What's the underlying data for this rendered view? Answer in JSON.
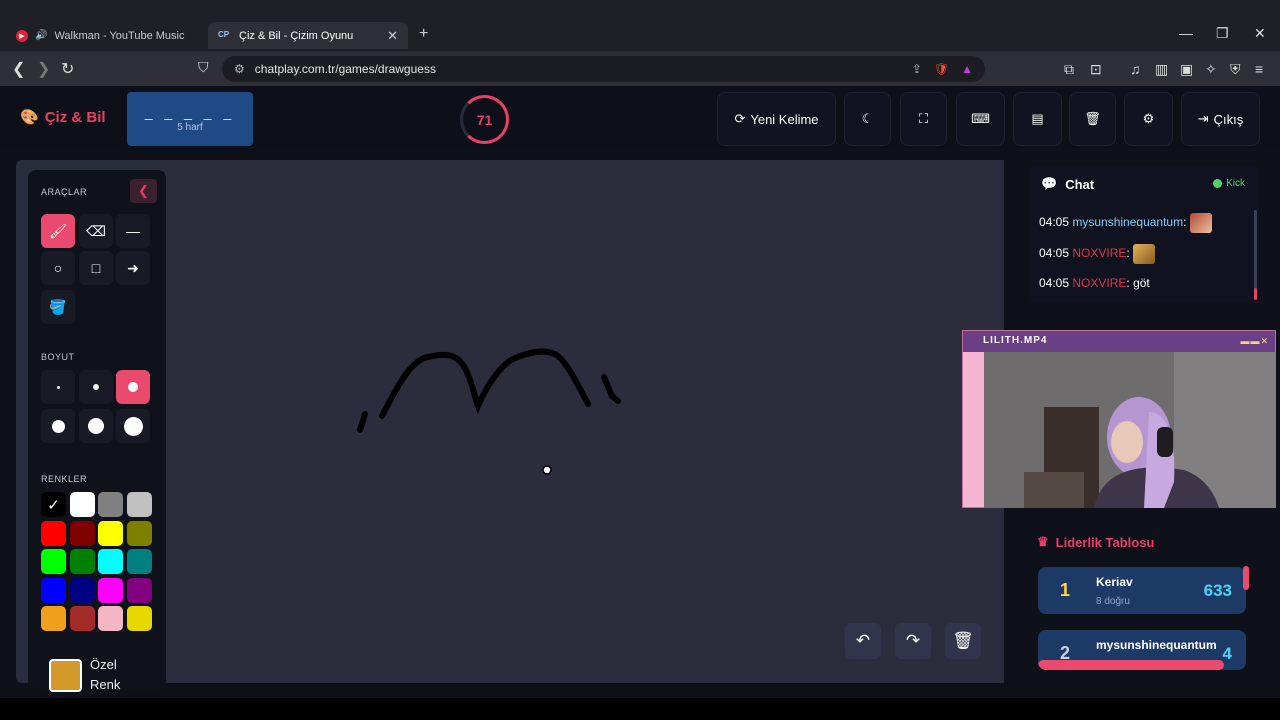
{
  "browser": {
    "tabs": [
      {
        "title": "Walkman - YouTube Music",
        "active": false
      },
      {
        "title": "Çiz & Bil - Çizim Oyunu",
        "active": true,
        "favicon": "CP"
      }
    ],
    "url": "chatplay.com.tr/games/drawguess"
  },
  "header": {
    "logo": "Çiz & Bil",
    "word_mask": "_ _ _ _ _",
    "word_hint": "5 harf",
    "timer": "71",
    "new_word_label": "Yeni Kelime",
    "exit_label": "Çıkış"
  },
  "tools": {
    "tools_title": "ARAÇLAR",
    "size_title": "BOYUT",
    "colors_title": "RENKLER",
    "custom_color_label": "Özel Renk",
    "custom_color": "#d3992b",
    "selected_tool": "brush",
    "selected_size_index": 2,
    "selected_color": "#000000",
    "palette": [
      "#000000",
      "#ffffff",
      "#808080",
      "#c0c0c0",
      "#ff0000",
      "#800000",
      "#ffff00",
      "#808000",
      "#00ff00",
      "#008000",
      "#00ffff",
      "#008080",
      "#0000ff",
      "#000080",
      "#ff00ff",
      "#800080",
      "#f0a01c",
      "#a52a2a",
      "#f4b6c2",
      "#e6d800"
    ]
  },
  "chat": {
    "title": "Chat",
    "status": "Kick",
    "messages": [
      {
        "time": "04:05",
        "user": "mysunshinequantum",
        "text": "",
        "emote": true
      },
      {
        "time": "04:05",
        "user": "NOXVIRE",
        "text": "",
        "emote": true
      },
      {
        "time": "04:05",
        "user": "NOXVIRE",
        "text": "göt",
        "emote": false
      }
    ]
  },
  "overlay": {
    "title": "LILITH.MP4"
  },
  "leaderboard": {
    "title": "Liderlik Tablosu",
    "rows": [
      {
        "rank": "1",
        "name": "Keriav",
        "sub": "8 doğru",
        "points": "633"
      },
      {
        "rank": "2",
        "name": "mysunshinequantum",
        "sub": "",
        "points": "4"
      }
    ]
  }
}
